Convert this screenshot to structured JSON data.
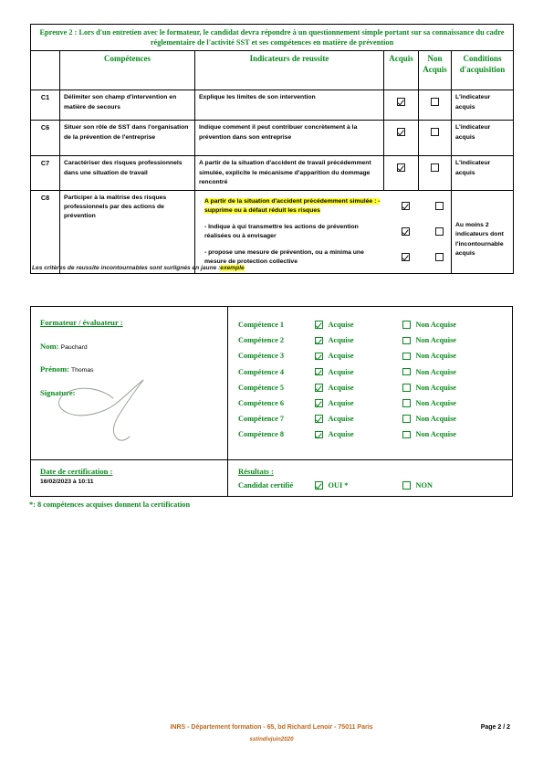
{
  "colors": {
    "green": "#0a8a1e",
    "orange": "#c4671c",
    "highlight": "#ffff2e",
    "black": "#000000"
  },
  "exam": {
    "title": "Epreuve 2 : Lors d'un entretien avec le formateur, le candidat devra répondre à un questionnement simple portant sur sa connaissance du cadre réglementaire de l'activité SST et ses compétences en matière de prévention",
    "headers": {
      "code": "",
      "competences": "Compétences",
      "indicateurs": "Indicateurs de reussite",
      "acquis": "Acquis",
      "non_acquis": "Non Acquis",
      "conditions": "Conditions d'acquisition"
    },
    "rows": [
      {
        "code": "C1",
        "competence": "Délimiter son champ d'intervention en matière de secours",
        "indicators": [
          {
            "text": "Explique les limites de son intervention",
            "highlighted": false,
            "acquis": true,
            "non_acquis": false
          }
        ],
        "condition": "L'indicateur acquis"
      },
      {
        "code": "C6",
        "competence": "Situer son rôle de SST dans l'organisation de la prévention de l'entreprise",
        "indicators": [
          {
            "text": "Indique comment il peut contribuer concrètement à la prévention dans son entreprise",
            "highlighted": false,
            "acquis": true,
            "non_acquis": false
          }
        ],
        "condition": "L'indicateur acquis"
      },
      {
        "code": "C7",
        "competence": "Caractériser des risques professionnels dans une situation de travail",
        "indicators": [
          {
            "text": "A partir de la situation d'accident de travail précédemment simulée, explicite le mécanisme d'apparition du dommage rencontré",
            "highlighted": false,
            "acquis": true,
            "non_acquis": false
          }
        ],
        "condition": "L'indicateur acquis"
      },
      {
        "code": "C8",
        "competence": "Participer à la maîtrise des risques professionnels par des actions de prévention",
        "indicators": [
          {
            "text": "A partir de la situation d'accident précédemment simulée : - supprime ou à défaut réduit les risques",
            "highlighted": true,
            "acquis": true,
            "non_acquis": false
          },
          {
            "text": "- Indique à qui transmettre les actions de prévention réalisées ou à envisager",
            "highlighted": false,
            "acquis": true,
            "non_acquis": false
          },
          {
            "text": "- propose une mesure de prévention, ou a minima une mesure de protection collective",
            "highlighted": false,
            "acquis": true,
            "non_acquis": false
          }
        ],
        "condition": "Au moins 2 indicateurs dont l'incontournable acquis"
      }
    ],
    "note_prefix": "Les critères de reussite incontournables sont surlignés en jaune :",
    "note_highlight": "exemple"
  },
  "form": {
    "trainer": {
      "heading": "Formateur / évaluateur :",
      "nom_label": "Nom:",
      "nom_value": "Pauchard",
      "prenom_label": "Prénom:",
      "prenom_value": "Thomas",
      "signature_label": "Signature:"
    },
    "competences": [
      {
        "label": "Compétence 1",
        "acquise_label": "Acquise",
        "non_acquise_label": "Non Acquise",
        "acquise": true,
        "non_acquise": false
      },
      {
        "label": "Compétence 2",
        "acquise_label": "Acquise",
        "non_acquise_label": "Non Acquise",
        "acquise": true,
        "non_acquise": false
      },
      {
        "label": "Compétence 3",
        "acquise_label": "Acquise",
        "non_acquise_label": "Non Acquise",
        "acquise": true,
        "non_acquise": false
      },
      {
        "label": "Compétence 4",
        "acquise_label": "Acquise",
        "non_acquise_label": "Non Acquise",
        "acquise": true,
        "non_acquise": false
      },
      {
        "label": "Compétence 5",
        "acquise_label": "Acquise",
        "non_acquise_label": "Non Acquise",
        "acquise": true,
        "non_acquise": false
      },
      {
        "label": "Compétence 6",
        "acquise_label": "Acquise",
        "non_acquise_label": "Non Acquise",
        "acquise": true,
        "non_acquise": false
      },
      {
        "label": "Compétence 7",
        "acquise_label": "Acquise",
        "non_acquise_label": "Non Acquise",
        "acquise": true,
        "non_acquise": false
      },
      {
        "label": "Compétence 8",
        "acquise_label": "Acquise",
        "non_acquise_label": "Non Acquise",
        "acquise": true,
        "non_acquise": false
      }
    ],
    "certification": {
      "date_label": "Date de certification :",
      "date_value": "16/02/2023 à 10:11",
      "results_label": "Résultats :",
      "candidat_label": "Candidat certifié",
      "oui_label": "OUI *",
      "non_label": "NON",
      "oui_checked": true,
      "non_checked": false
    },
    "star_note": "*: 8 compétences acquises donnent la certification"
  },
  "footer": {
    "organization": "INRS - Département formation - 65, bd Richard Lenoir - 75011 Paris",
    "reference": "sstindivjuin2020",
    "page": "Page 2 / 2"
  }
}
